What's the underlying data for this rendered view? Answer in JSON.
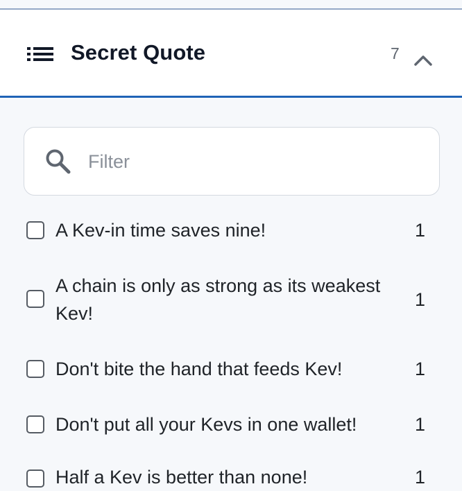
{
  "header": {
    "title": "Secret Quote",
    "count": "7",
    "icons": {
      "list": "list-icon",
      "collapse": "chevron-up-icon"
    }
  },
  "filter": {
    "placeholder": "Filter",
    "value": "",
    "icon": "search-icon"
  },
  "items": [
    {
      "label": "A Kev-in time saves nine!",
      "count": "1",
      "checked": false
    },
    {
      "label": "A chain is only as strong as its weakest Kev!",
      "count": "1",
      "checked": false
    },
    {
      "label": "Don't bite the hand that feeds Kev!",
      "count": "1",
      "checked": false
    },
    {
      "label": "Don't put all your Kevs in one wallet!",
      "count": "1",
      "checked": false
    },
    {
      "label": "Half a Kev is better than none!",
      "count": "1",
      "checked": false
    }
  ],
  "colors": {
    "accent": "#1f63b6",
    "background": "#f6f8fb",
    "text": "#1f2328"
  }
}
